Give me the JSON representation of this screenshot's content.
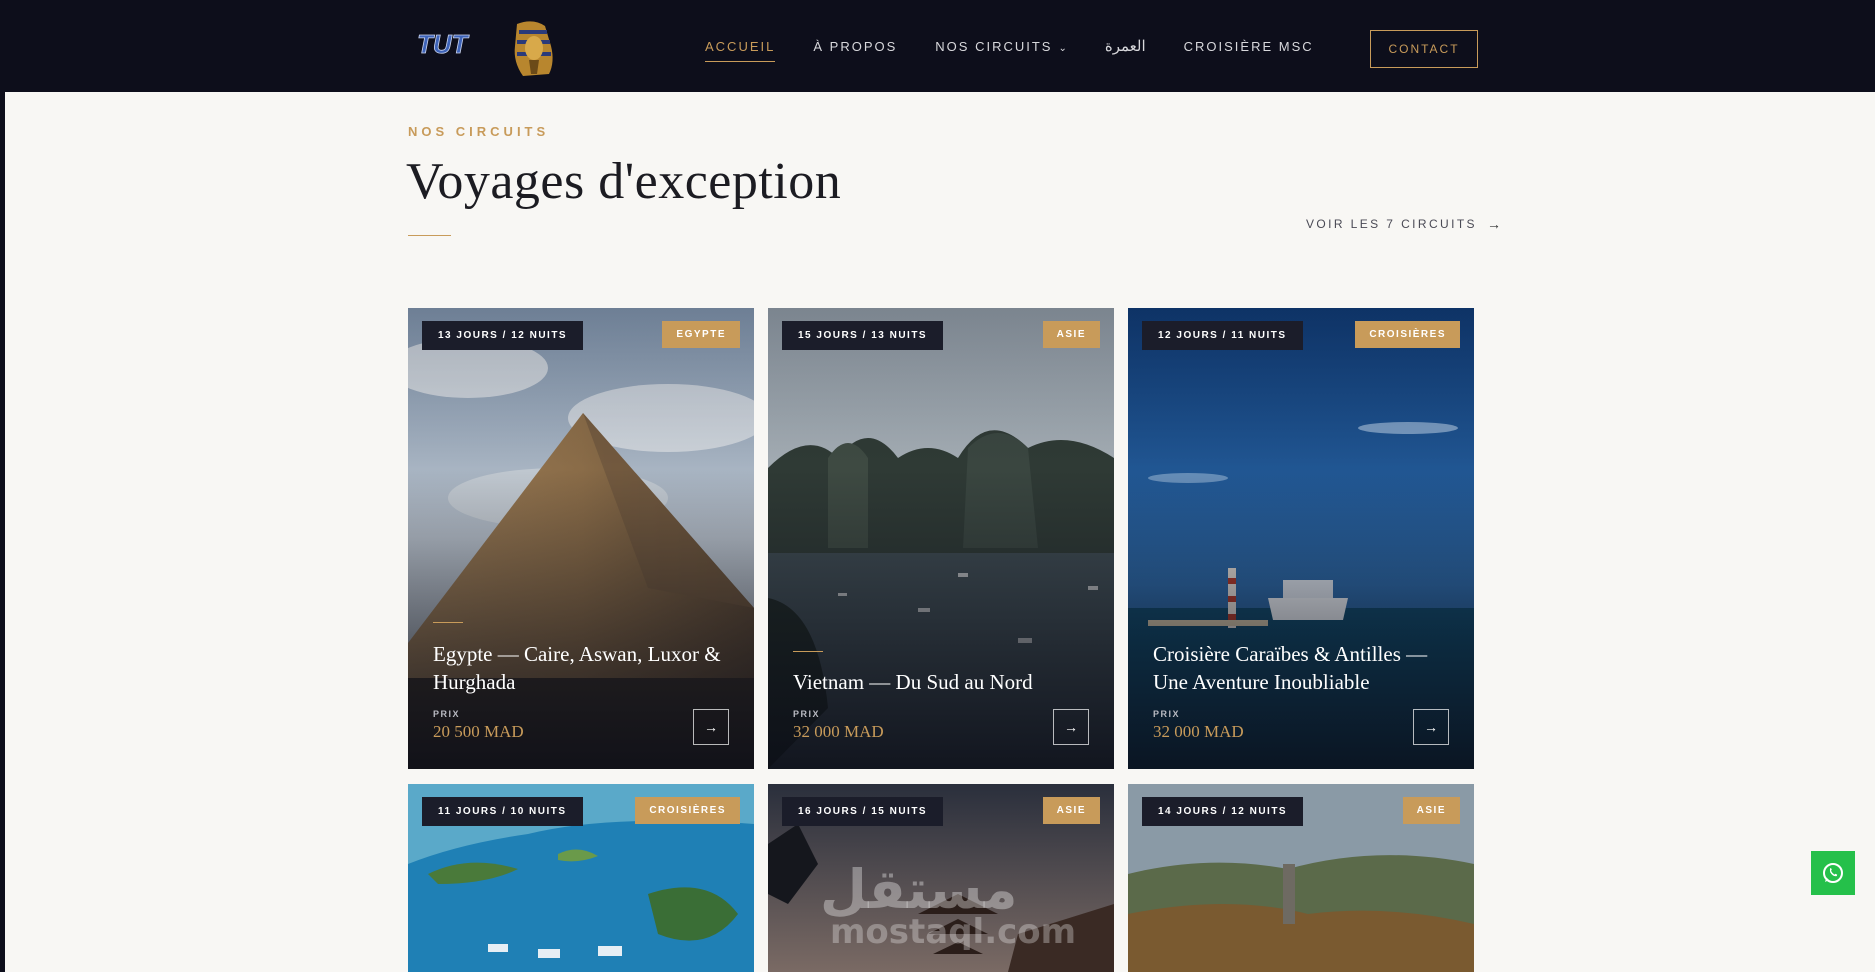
{
  "header": {
    "logo_text": "TUT",
    "nav": [
      {
        "label": "ACCUEIL",
        "active": true
      },
      {
        "label": "À PROPOS"
      },
      {
        "label": "NOS CIRCUITS",
        "has_dropdown": true
      },
      {
        "label": "العمرة"
      },
      {
        "label": "CROISIÈRE MSC"
      }
    ],
    "contact_label": "CONTACT"
  },
  "section": {
    "eyebrow": "NOS CIRCUITS",
    "title": "Voyages d'exception",
    "see_all": "VOIR LES 7 CIRCUITS"
  },
  "cards": [
    {
      "days": "13 JOURS / 12 NUITS",
      "category": "EGYPTE",
      "title": "Egypte — Caire, Aswan, Luxor & Hurghada",
      "price_label": "PRIX",
      "price": "20 500 MAD"
    },
    {
      "days": "15 JOURS / 13 NUITS",
      "category": "ASIE",
      "title": "Vietnam — Du Sud au Nord",
      "price_label": "PRIX",
      "price": "32 000 MAD"
    },
    {
      "days": "12 JOURS / 11 NUITS",
      "category": "CROISIÈRES",
      "title": "Croisière Caraïbes & Antilles — Une Aventure Inoubliable",
      "price_label": "PRIX",
      "price": "32 000 MAD"
    },
    {
      "days": "11 JOURS / 10 NUITS",
      "category": "CROISIÈRES"
    },
    {
      "days": "16 JOURS / 15 NUITS",
      "category": "ASIE"
    },
    {
      "days": "14 JOURS / 12 NUITS",
      "category": "ASIE"
    }
  ],
  "watermark": {
    "line1": "مستقل",
    "line2": "mostaql.com"
  },
  "colors": {
    "header_bg": "#0d0e1b",
    "accent_gold": "#c89b5a",
    "page_bg": "#f8f7f4",
    "whatsapp": "#25c04a"
  }
}
